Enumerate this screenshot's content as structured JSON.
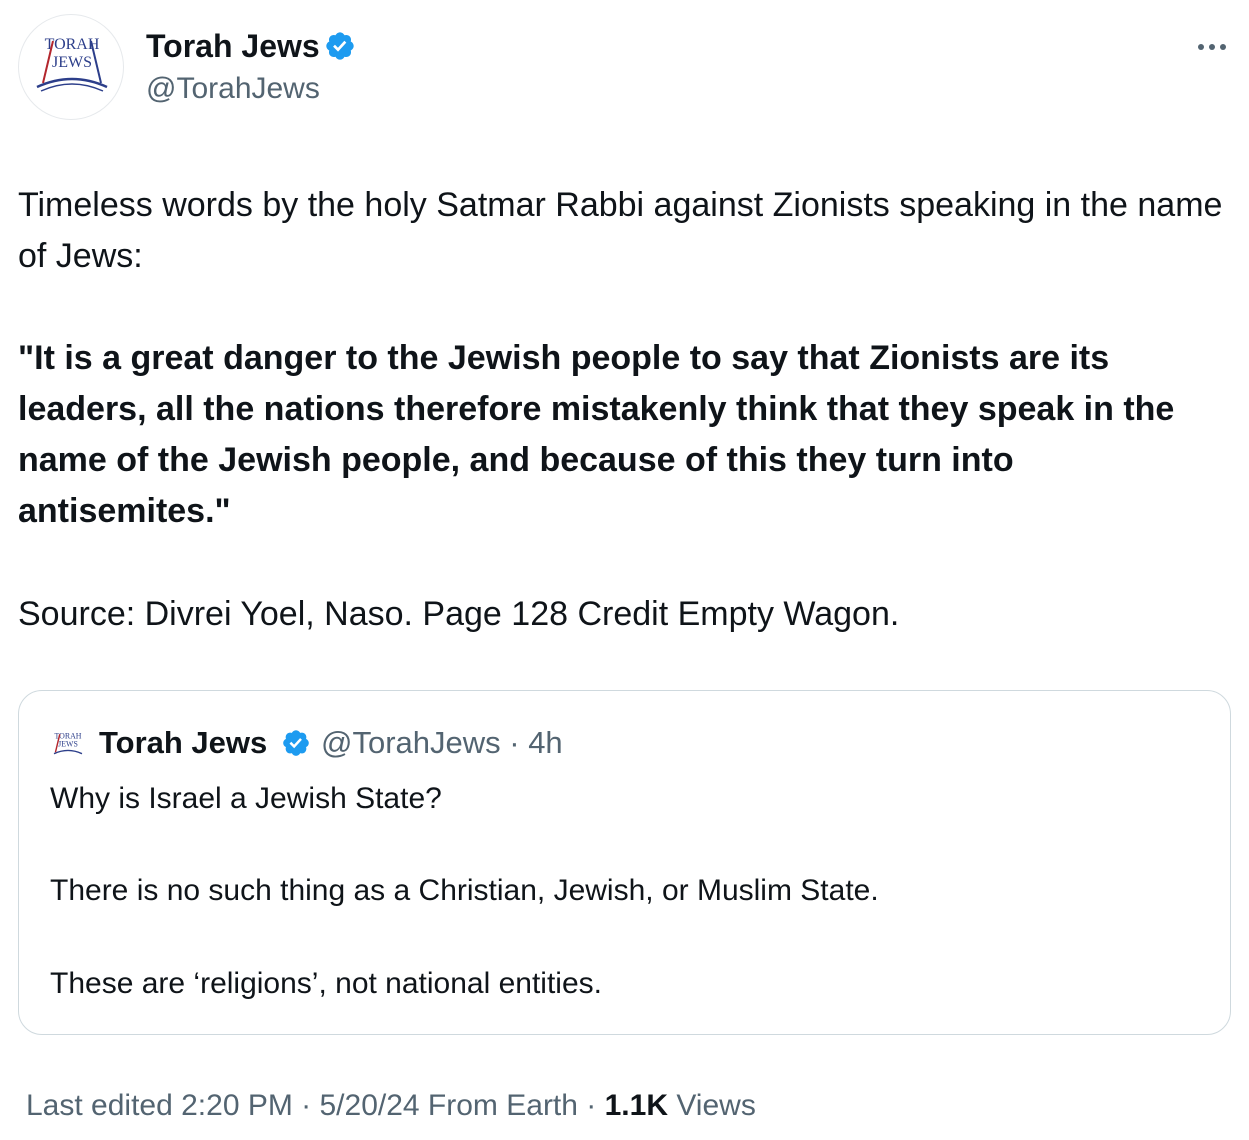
{
  "author": {
    "name": "Torah Jews",
    "handle": "@TorahJews",
    "logo_text": [
      "TORAH",
      "JEWS"
    ]
  },
  "tweet": {
    "paragraph_1": "Timeless words by the holy Satmar Rabbi against Zionists speaking in the name of Jews:",
    "paragraph_2": "\"It is a great danger to the Jewish people to say that Zionists are its leaders, all the nations therefore mistakenly think that they speak in the name of the Jewish people, and because of this they turn into antisemites.\"",
    "paragraph_3": "Source: Divrei Yoel, Naso. Page 128 Credit Empty Wagon."
  },
  "quoted_tweet": {
    "name": "Torah Jews",
    "handle_time": "@TorahJews · 4h",
    "line_1": "Why is Israel a Jewish State?",
    "line_2": "There is no such thing as a Christian, Jewish, or Muslim State.",
    "line_3": "These are ‘religions’, not national entities."
  },
  "footer": {
    "edited": "Last edited 2:20 PM · 5/20/24  From Earth · ",
    "views_count": "1.1K",
    "views_label": " Views"
  },
  "icons": {
    "verified": "verified-badge-icon",
    "more": "more-options-icon"
  },
  "colors": {
    "text": "#0f1419",
    "secondary": "#536471",
    "verified": "#1d9bf0",
    "border": "#cfd9de",
    "logo_blue": "#2c3e8a",
    "logo_red": "#b3262d"
  }
}
